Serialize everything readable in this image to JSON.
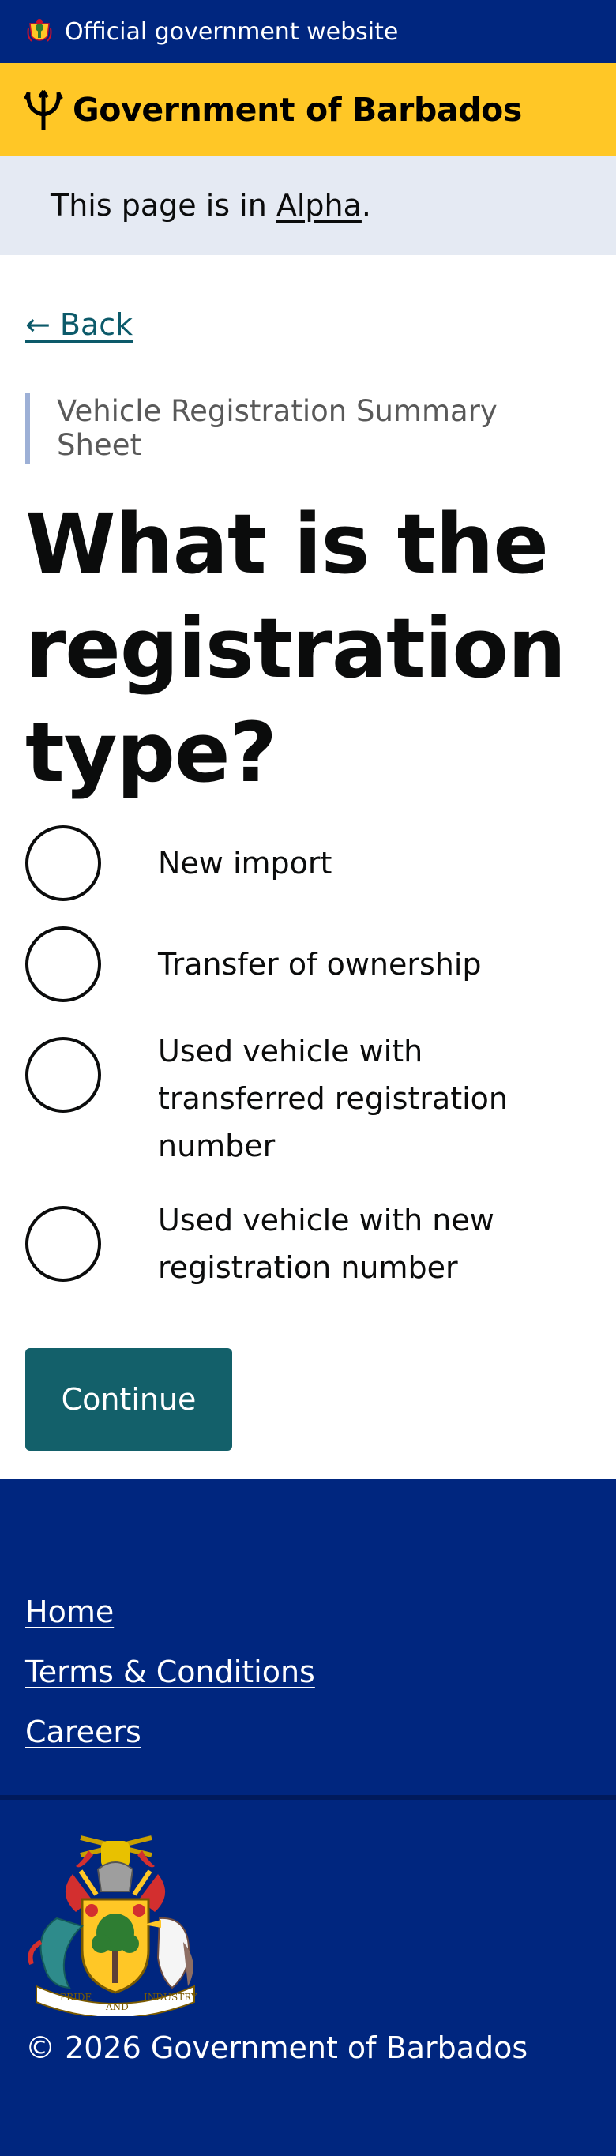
{
  "header": {
    "official_text": "Official government website",
    "site_title": "Government of Barbados"
  },
  "phase_banner": {
    "text_prefix": "This page is in ",
    "phase_link": "Alpha",
    "text_suffix": "."
  },
  "main": {
    "back_link": "← Back",
    "caption": "Vehicle Registration Summary Sheet",
    "question": "What is the registration type?",
    "options": [
      "New import",
      "Transfer of ownership",
      "Used vehicle with transferred registration number",
      "Used vehicle with new registration number"
    ],
    "continue_label": "Continue"
  },
  "footer": {
    "links": [
      "Home",
      "Terms & Conditions",
      "Careers"
    ],
    "copyright": "© 2026 Government of Barbados",
    "motto_left": "PRIDE",
    "motto_mid": "AND",
    "motto_right": "INDUSTRY"
  },
  "colors": {
    "navy": "#00267f",
    "gold": "#ffc726",
    "teal": "#13606a"
  }
}
